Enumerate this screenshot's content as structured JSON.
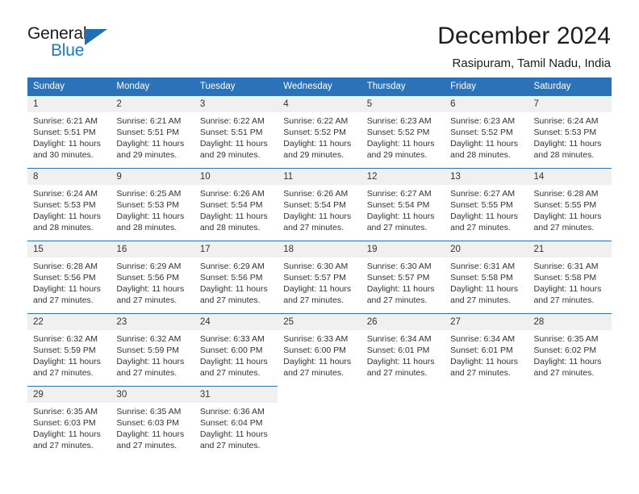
{
  "brand": {
    "name_part1": "General",
    "name_part2": "Blue",
    "logo_icon": "triangle-logo-icon",
    "accent_color": "#1f6fb5"
  },
  "header": {
    "title": "December 2024",
    "subtitle": "Rasipuram, Tamil Nadu, India"
  },
  "theme": {
    "header_bg": "#2c72b8",
    "daynum_bg": "#f0f0f0",
    "text": "#333333"
  },
  "calendar": {
    "weekday_headers": [
      "Sunday",
      "Monday",
      "Tuesday",
      "Wednesday",
      "Thursday",
      "Friday",
      "Saturday"
    ],
    "weeks": [
      [
        {
          "day": "1",
          "sunrise": "Sunrise: 6:21 AM",
          "sunset": "Sunset: 5:51 PM",
          "daylight1": "Daylight: 11 hours",
          "daylight2": "and 30 minutes."
        },
        {
          "day": "2",
          "sunrise": "Sunrise: 6:21 AM",
          "sunset": "Sunset: 5:51 PM",
          "daylight1": "Daylight: 11 hours",
          "daylight2": "and 29 minutes."
        },
        {
          "day": "3",
          "sunrise": "Sunrise: 6:22 AM",
          "sunset": "Sunset: 5:51 PM",
          "daylight1": "Daylight: 11 hours",
          "daylight2": "and 29 minutes."
        },
        {
          "day": "4",
          "sunrise": "Sunrise: 6:22 AM",
          "sunset": "Sunset: 5:52 PM",
          "daylight1": "Daylight: 11 hours",
          "daylight2": "and 29 minutes."
        },
        {
          "day": "5",
          "sunrise": "Sunrise: 6:23 AM",
          "sunset": "Sunset: 5:52 PM",
          "daylight1": "Daylight: 11 hours",
          "daylight2": "and 29 minutes."
        },
        {
          "day": "6",
          "sunrise": "Sunrise: 6:23 AM",
          "sunset": "Sunset: 5:52 PM",
          "daylight1": "Daylight: 11 hours",
          "daylight2": "and 28 minutes."
        },
        {
          "day": "7",
          "sunrise": "Sunrise: 6:24 AM",
          "sunset": "Sunset: 5:53 PM",
          "daylight1": "Daylight: 11 hours",
          "daylight2": "and 28 minutes."
        }
      ],
      [
        {
          "day": "8",
          "sunrise": "Sunrise: 6:24 AM",
          "sunset": "Sunset: 5:53 PM",
          "daylight1": "Daylight: 11 hours",
          "daylight2": "and 28 minutes."
        },
        {
          "day": "9",
          "sunrise": "Sunrise: 6:25 AM",
          "sunset": "Sunset: 5:53 PM",
          "daylight1": "Daylight: 11 hours",
          "daylight2": "and 28 minutes."
        },
        {
          "day": "10",
          "sunrise": "Sunrise: 6:26 AM",
          "sunset": "Sunset: 5:54 PM",
          "daylight1": "Daylight: 11 hours",
          "daylight2": "and 28 minutes."
        },
        {
          "day": "11",
          "sunrise": "Sunrise: 6:26 AM",
          "sunset": "Sunset: 5:54 PM",
          "daylight1": "Daylight: 11 hours",
          "daylight2": "and 27 minutes."
        },
        {
          "day": "12",
          "sunrise": "Sunrise: 6:27 AM",
          "sunset": "Sunset: 5:54 PM",
          "daylight1": "Daylight: 11 hours",
          "daylight2": "and 27 minutes."
        },
        {
          "day": "13",
          "sunrise": "Sunrise: 6:27 AM",
          "sunset": "Sunset: 5:55 PM",
          "daylight1": "Daylight: 11 hours",
          "daylight2": "and 27 minutes."
        },
        {
          "day": "14",
          "sunrise": "Sunrise: 6:28 AM",
          "sunset": "Sunset: 5:55 PM",
          "daylight1": "Daylight: 11 hours",
          "daylight2": "and 27 minutes."
        }
      ],
      [
        {
          "day": "15",
          "sunrise": "Sunrise: 6:28 AM",
          "sunset": "Sunset: 5:56 PM",
          "daylight1": "Daylight: 11 hours",
          "daylight2": "and 27 minutes."
        },
        {
          "day": "16",
          "sunrise": "Sunrise: 6:29 AM",
          "sunset": "Sunset: 5:56 PM",
          "daylight1": "Daylight: 11 hours",
          "daylight2": "and 27 minutes."
        },
        {
          "day": "17",
          "sunrise": "Sunrise: 6:29 AM",
          "sunset": "Sunset: 5:56 PM",
          "daylight1": "Daylight: 11 hours",
          "daylight2": "and 27 minutes."
        },
        {
          "day": "18",
          "sunrise": "Sunrise: 6:30 AM",
          "sunset": "Sunset: 5:57 PM",
          "daylight1": "Daylight: 11 hours",
          "daylight2": "and 27 minutes."
        },
        {
          "day": "19",
          "sunrise": "Sunrise: 6:30 AM",
          "sunset": "Sunset: 5:57 PM",
          "daylight1": "Daylight: 11 hours",
          "daylight2": "and 27 minutes."
        },
        {
          "day": "20",
          "sunrise": "Sunrise: 6:31 AM",
          "sunset": "Sunset: 5:58 PM",
          "daylight1": "Daylight: 11 hours",
          "daylight2": "and 27 minutes."
        },
        {
          "day": "21",
          "sunrise": "Sunrise: 6:31 AM",
          "sunset": "Sunset: 5:58 PM",
          "daylight1": "Daylight: 11 hours",
          "daylight2": "and 27 minutes."
        }
      ],
      [
        {
          "day": "22",
          "sunrise": "Sunrise: 6:32 AM",
          "sunset": "Sunset: 5:59 PM",
          "daylight1": "Daylight: 11 hours",
          "daylight2": "and 27 minutes."
        },
        {
          "day": "23",
          "sunrise": "Sunrise: 6:32 AM",
          "sunset": "Sunset: 5:59 PM",
          "daylight1": "Daylight: 11 hours",
          "daylight2": "and 27 minutes."
        },
        {
          "day": "24",
          "sunrise": "Sunrise: 6:33 AM",
          "sunset": "Sunset: 6:00 PM",
          "daylight1": "Daylight: 11 hours",
          "daylight2": "and 27 minutes."
        },
        {
          "day": "25",
          "sunrise": "Sunrise: 6:33 AM",
          "sunset": "Sunset: 6:00 PM",
          "daylight1": "Daylight: 11 hours",
          "daylight2": "and 27 minutes."
        },
        {
          "day": "26",
          "sunrise": "Sunrise: 6:34 AM",
          "sunset": "Sunset: 6:01 PM",
          "daylight1": "Daylight: 11 hours",
          "daylight2": "and 27 minutes."
        },
        {
          "day": "27",
          "sunrise": "Sunrise: 6:34 AM",
          "sunset": "Sunset: 6:01 PM",
          "daylight1": "Daylight: 11 hours",
          "daylight2": "and 27 minutes."
        },
        {
          "day": "28",
          "sunrise": "Sunrise: 6:35 AM",
          "sunset": "Sunset: 6:02 PM",
          "daylight1": "Daylight: 11 hours",
          "daylight2": "and 27 minutes."
        }
      ],
      [
        {
          "day": "29",
          "sunrise": "Sunrise: 6:35 AM",
          "sunset": "Sunset: 6:03 PM",
          "daylight1": "Daylight: 11 hours",
          "daylight2": "and 27 minutes."
        },
        {
          "day": "30",
          "sunrise": "Sunrise: 6:35 AM",
          "sunset": "Sunset: 6:03 PM",
          "daylight1": "Daylight: 11 hours",
          "daylight2": "and 27 minutes."
        },
        {
          "day": "31",
          "sunrise": "Sunrise: 6:36 AM",
          "sunset": "Sunset: 6:04 PM",
          "daylight1": "Daylight: 11 hours",
          "daylight2": "and 27 minutes."
        },
        null,
        null,
        null,
        null
      ]
    ]
  }
}
